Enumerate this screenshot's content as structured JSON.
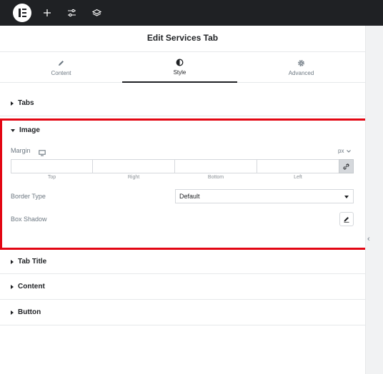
{
  "topbar": {
    "logo_icon": "elementor-logo-icon",
    "buttons": [
      {
        "name": "add-element-button",
        "icon": "plus-icon"
      },
      {
        "name": "site-settings-button",
        "icon": "sliders-icon"
      },
      {
        "name": "structure-button",
        "icon": "layers-icon"
      }
    ]
  },
  "panel": {
    "title": "Edit Services Tab",
    "tabs": [
      {
        "label": "Content",
        "icon": "pencil-icon",
        "active": false
      },
      {
        "label": "Style",
        "icon": "contrast-icon",
        "active": true
      },
      {
        "label": "Advanced",
        "icon": "gear-icon",
        "active": false
      }
    ],
    "sections": [
      {
        "label": "Tabs",
        "expanded": false
      },
      {
        "label": "Image",
        "expanded": true
      },
      {
        "label": "Tab Title",
        "expanded": false
      },
      {
        "label": "Content",
        "expanded": false
      },
      {
        "label": "Button",
        "expanded": false
      }
    ]
  },
  "image_section": {
    "margin_label": "Margin",
    "responsive_icon": "desktop-icon",
    "units": "px",
    "dimensions": [
      {
        "label": "Top",
        "value": ""
      },
      {
        "label": "Right",
        "value": ""
      },
      {
        "label": "Bottom",
        "value": ""
      },
      {
        "label": "Left",
        "value": ""
      }
    ],
    "link_icon": "link-icon",
    "border_type_label": "Border Type",
    "border_type_value": "Default",
    "box_shadow_label": "Box Shadow",
    "edit_icon": "pencil-icon"
  },
  "colors": {
    "topbar": "#1f2124",
    "highlight": "#e30613",
    "text": "#1f2124",
    "muted": "#6d7882"
  }
}
